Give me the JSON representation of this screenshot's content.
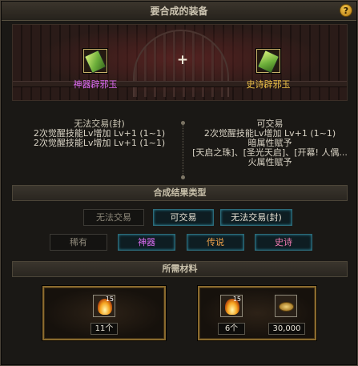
{
  "title": "要合成的装备",
  "help_icon": "?",
  "item_left": {
    "name": "神器辟邪玉",
    "color": "#e06cf5"
  },
  "item_right": {
    "name": "史诗辟邪玉",
    "color": "#f2c44a"
  },
  "plus_icon": "+",
  "left_desc": {
    "trade": "无法交易(封)",
    "lines": [
      "2次觉醒技能Lv增加 Lv+1 (1~1)",
      "2次觉醒技能Lv增加 Lv+1 (1~1)"
    ]
  },
  "right_desc": {
    "trade": "可交易",
    "lines": [
      "2次觉醒技能Lv增加 Lv+1 (1~1)",
      "暗属性赋予",
      "[天启之珠]、[圣光天启]、[开幕! 人偶...",
      "火属性赋予"
    ]
  },
  "result_section": {
    "title": "合成结果类型",
    "trade_options": [
      {
        "label": "无法交易",
        "selected": false
      },
      {
        "label": "可交易",
        "selected": true
      },
      {
        "label": "无法交易(封)",
        "selected": true
      }
    ],
    "grade_options": [
      {
        "label": "稀有",
        "selected": false
      },
      {
        "label": "神器",
        "selected": true
      },
      {
        "label": "传说",
        "selected": true
      },
      {
        "label": "史诗",
        "selected": true
      }
    ]
  },
  "materials": {
    "title": "所需材料",
    "left": [
      {
        "icon": "flame-icon",
        "badge": "15",
        "count": "11个"
      }
    ],
    "right": [
      {
        "icon": "flame-icon",
        "badge": "15",
        "count": "6个"
      },
      {
        "icon": "gold-coins-icon",
        "badge": "",
        "count": "30,000"
      }
    ]
  }
}
